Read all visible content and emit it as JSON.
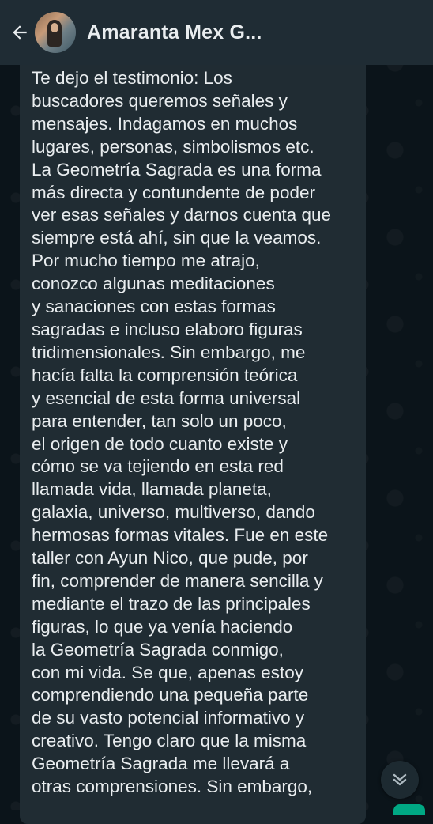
{
  "header": {
    "contact_name": "Amaranta Mex G...",
    "icons": [
      "back-arrow-icon",
      "video-call-icon",
      "voice-call-icon",
      "more-options-icon"
    ]
  },
  "message": {
    "lines": [
      "Te dejo el testimonio: Los",
      "buscadores queremos señales y",
      "mensajes. Indagamos en muchos",
      "lugares, personas, simbolismos etc.",
      "La Geometría Sagrada es una forma",
      "más directa y contundente de poder",
      "ver esas señales y darnos cuenta que",
      "siempre está ahí, sin que la veamos.",
      "Por mucho tiempo me atrajo,",
      "conozco algunas meditaciones",
      "y sanaciones con estas formas",
      "sagradas e incluso elaboro figuras",
      "tridimensionales. Sin embargo, me",
      "hacía falta la comprensión teórica",
      "y esencial de esta forma universal",
      "para entender, tan solo un poco,",
      "el origen de todo cuanto existe y",
      "cómo se va tejiendo en esta red",
      "llamada vida, llamada planeta,",
      "galaxia, universo, multiverso, dando",
      "hermosas formas vitales. Fue en este",
      "taller con Ayun Nico, que pude, por",
      "fin, comprender de manera sencilla y",
      "mediante el trazo de las principales",
      "figuras, lo que ya venía haciendo",
      "la Geometría Sagrada conmigo,",
      "con mi vida. Se que, apenas estoy",
      "comprendiendo una pequeña parte",
      "de su vasto potencial informativo y",
      "creativo. Tengo claro que la misma",
      "Geometría Sagrada me llevará a",
      "otras comprensiones. Sin embargo,"
    ]
  },
  "colors": {
    "header_bg": "#1f2c34",
    "chat_bg": "#0b141a",
    "bubble_bg": "#202c33",
    "text": "#e9edef",
    "accent": "#00a884"
  },
  "scroll_button": {
    "icon": "double-chevron-down-icon"
  }
}
